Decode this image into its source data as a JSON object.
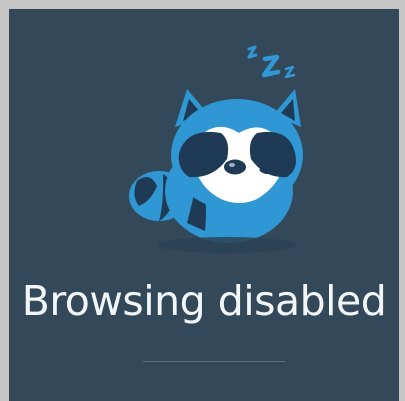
{
  "page": {
    "title": "Browsing disabled"
  },
  "mascot": {
    "icon": "sleeping-raccoon-icon",
    "sleep_marks": "z z Z"
  },
  "colors": {
    "background": "#33495a",
    "frame": "#c6c6c6",
    "accent_blue": "#2f97d4",
    "dark_navy": "#1e3a54",
    "text": "#f3f6f8"
  }
}
